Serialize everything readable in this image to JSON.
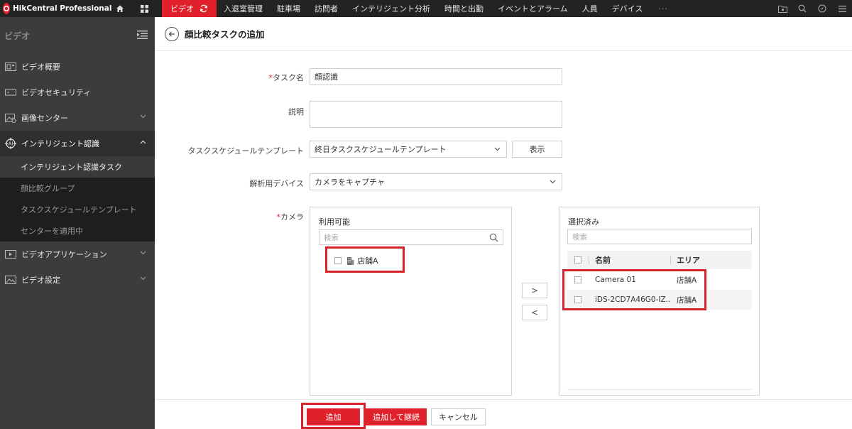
{
  "app": {
    "title": "HikCentral Professional"
  },
  "top_nav": {
    "items": [
      "ビデオ",
      "入退室管理",
      "駐車場",
      "訪問者",
      "インテリジェント分析",
      "時間と出勤",
      "イベントとアラーム",
      "人員",
      "デバイス"
    ],
    "more": "···"
  },
  "sidebar": {
    "heading": "ビデオ",
    "items": [
      {
        "label": "ビデオ概要",
        "icon": "video-overview-icon"
      },
      {
        "label": "ビデオセキュリティ",
        "icon": "video-security-icon"
      },
      {
        "label": "画像センター",
        "icon": "image-center-icon"
      },
      {
        "label": "インテリジェント認識",
        "icon": "intelligent-recognition-icon"
      },
      {
        "label": "ビデオアプリケーション",
        "icon": "video-application-icon"
      },
      {
        "label": "ビデオ設定",
        "icon": "video-settings-icon"
      }
    ],
    "subitems": [
      "インテリジェント認識タスク",
      "顔比較グループ",
      "タスクスケジュールテンプレート",
      "センターを適用中"
    ]
  },
  "page": {
    "title": "顔比較タスクの追加"
  },
  "form": {
    "required_mark": "*",
    "task_name_label": "タスク名",
    "task_name_value": "顔認識",
    "description_label": "説明",
    "description_value": "",
    "schedule_label": "タスクスケジュールテンプレート",
    "schedule_value": "終日タスクスケジュールテンプレート",
    "show_button": "表示",
    "device_label": "解析用デバイス",
    "device_value": "カメラをキャプチャ",
    "camera_label": "カメラ"
  },
  "available": {
    "title": "利用可能",
    "search_placeholder": "検索",
    "nodes": [
      "店舗A"
    ]
  },
  "move_buttons": {
    "add": ">",
    "remove": "<"
  },
  "selected": {
    "title": "選択済み",
    "search_placeholder": "検索",
    "columns": [
      "名前",
      "エリア"
    ],
    "rows": [
      {
        "name": "Camera 01",
        "area": "店舗A"
      },
      {
        "name": "iDS-2CD7A46G0-IZ...",
        "area": "店舗A"
      }
    ]
  },
  "footer": {
    "add": "追加",
    "add_continue": "追加して継続",
    "cancel": "キャンセル"
  },
  "colors": {
    "accent": "#e0212b",
    "sidebar": "#3c3c3c",
    "topbar": "#232323"
  }
}
